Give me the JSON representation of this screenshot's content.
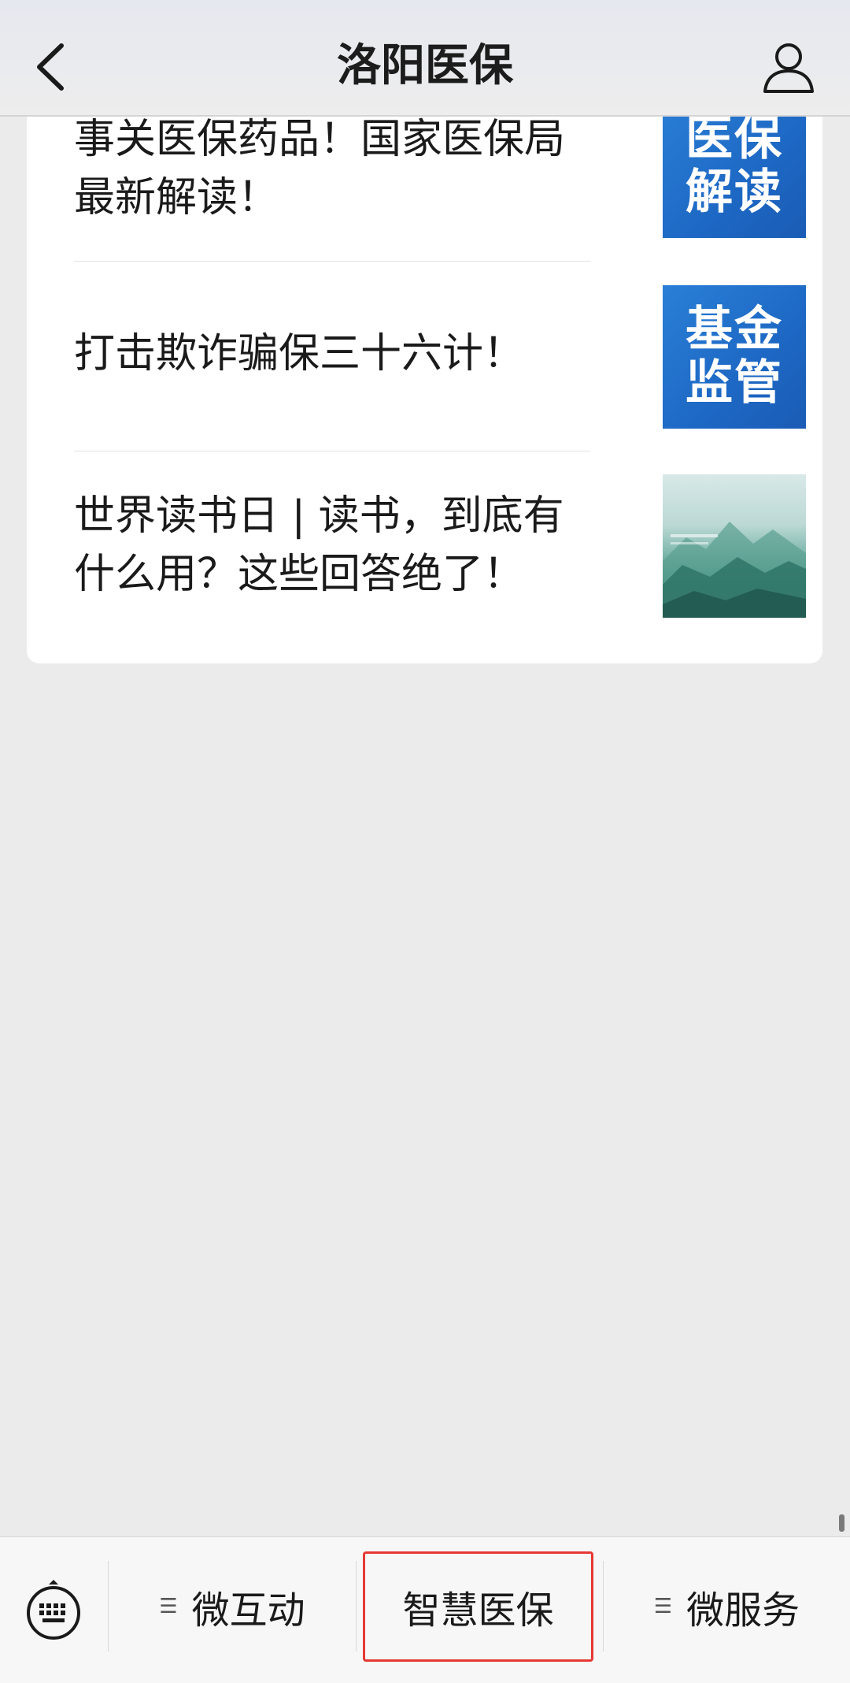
{
  "header": {
    "title": "洛阳医保",
    "back_icon": "chevron-left-icon",
    "profile_icon": "user-icon"
  },
  "articles": [
    {
      "title_line1": "事关医保药品！国家医保局",
      "title_line2": "最新解读！",
      "thumb_text_line1": "医保",
      "thumb_text_line2": "解读"
    },
    {
      "title_line1": "打击欺诈骗保三十六计！",
      "title_line2": "",
      "thumb_text_line1": "基金",
      "thumb_text_line2": "监管"
    },
    {
      "title_line1": "世界读书日 | 读书，到底有",
      "title_line2": "什么用？这些回答绝了！",
      "thumb_text_line1": "",
      "thumb_text_line2": ""
    }
  ],
  "bottom_menu": {
    "keyboard_icon": "keyboard-icon",
    "items": [
      {
        "label": "微互动",
        "icon": "menu-list-icon"
      },
      {
        "label": "智慧医保",
        "icon": ""
      },
      {
        "label": "微服务",
        "icon": "menu-list-icon"
      }
    ],
    "highlight_color": "#e53935"
  },
  "colors": {
    "thumb_blue": "#1d68c4",
    "background": "#ebebeb"
  }
}
